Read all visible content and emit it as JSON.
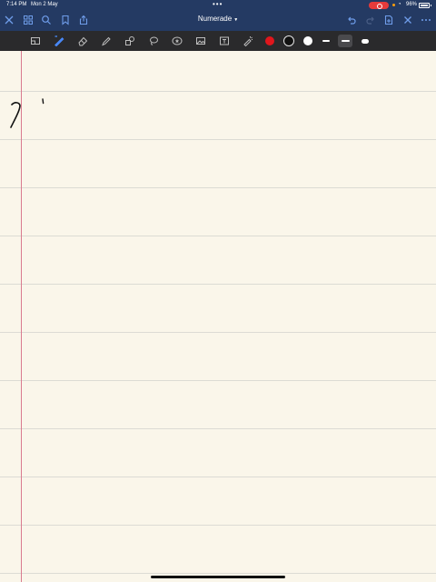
{
  "status_bar": {
    "time": "7:14 PM",
    "date": "Mon 2 May",
    "battery": "96%",
    "recording_color": "#e63b3b"
  },
  "nav": {
    "title": "Numerade",
    "left_icons": [
      "close-icon",
      "grid-icon",
      "search-icon",
      "bookmark-icon",
      "share-icon"
    ],
    "right_icons": [
      "undo-icon",
      "redo-icon",
      "add-page-icon",
      "close-icon",
      "more-icon"
    ],
    "accent": "#6f9dea",
    "background": "#243a63"
  },
  "toolbar": {
    "background": "#2a2a2c",
    "tools": [
      "zoom-window",
      "pen",
      "eraser",
      "highlighter",
      "shapes",
      "lasso",
      "sticker",
      "image",
      "text",
      "laser-pointer"
    ],
    "active_tool": "pen",
    "colors": [
      "#e0161c",
      "#111111",
      "#ffffff"
    ],
    "selected_color": "#111111",
    "selected_stroke": "medium"
  },
  "paper": {
    "background": "#faf6ea",
    "rule_color": "#dcdbd4",
    "margin_color": "#d97b8f"
  }
}
